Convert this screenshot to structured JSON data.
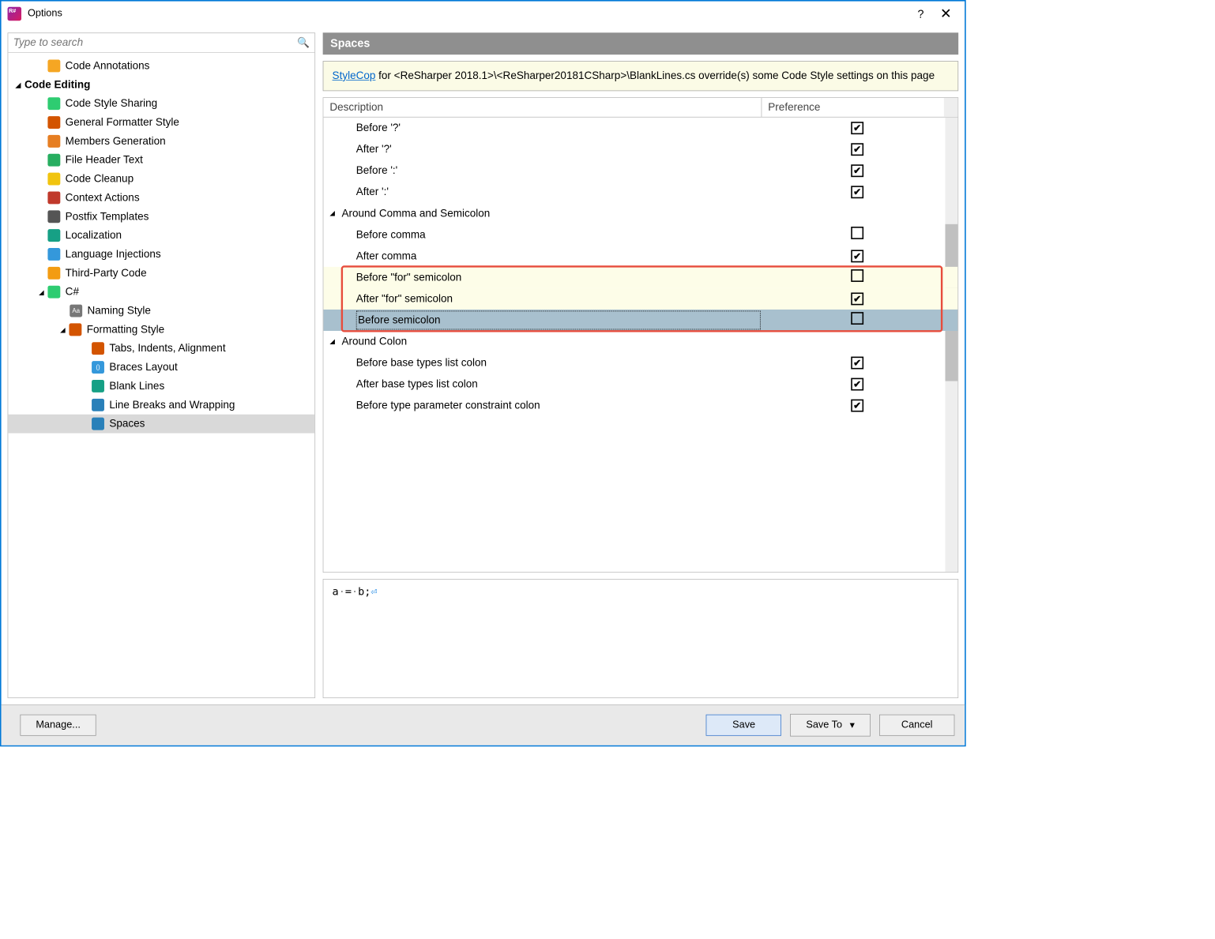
{
  "window": {
    "title": "Options"
  },
  "search": {
    "placeholder": "Type to search"
  },
  "sidebar": {
    "items": [
      {
        "label": "Code Annotations",
        "indent": 55,
        "iconColor": "#f5a623"
      },
      {
        "label": "Code Editing",
        "indent": 18,
        "header": true,
        "exp": "◢"
      },
      {
        "label": "Code Style Sharing",
        "indent": 55,
        "iconColor": "#2ecc71"
      },
      {
        "label": "General Formatter Style",
        "indent": 55,
        "iconColor": "#d35400"
      },
      {
        "label": "Members Generation",
        "indent": 55,
        "iconColor": "#e67e22"
      },
      {
        "label": "File Header Text",
        "indent": 55,
        "iconColor": "#27ae60"
      },
      {
        "label": "Code Cleanup",
        "indent": 55,
        "iconColor": "#f1c40f"
      },
      {
        "label": "Context Actions",
        "indent": 55,
        "iconColor": "#c0392b"
      },
      {
        "label": "Postfix Templates",
        "indent": 55,
        "iconColor": "#555"
      },
      {
        "label": "Localization",
        "indent": 55,
        "iconColor": "#16a085"
      },
      {
        "label": "Language Injections",
        "indent": 55,
        "iconColor": "#3498db"
      },
      {
        "label": "Third-Party Code",
        "indent": 55,
        "iconColor": "#f39c12"
      },
      {
        "label": "C#",
        "indent": 55,
        "iconColor": "#2ecc71",
        "exp": "◢",
        "expIndent": 38
      },
      {
        "label": "Naming Style",
        "indent": 90,
        "iconColor": "#777",
        "iconText": "Aa"
      },
      {
        "label": "Formatting Style",
        "indent": 90,
        "iconColor": "#d35400",
        "exp": "◢",
        "expIndent": 72
      },
      {
        "label": "Tabs, Indents, Alignment",
        "indent": 125,
        "iconColor": "#d35400"
      },
      {
        "label": "Braces Layout",
        "indent": 125,
        "iconColor": "#3498db",
        "iconText": "()"
      },
      {
        "label": "Blank Lines",
        "indent": 125,
        "iconColor": "#16a085"
      },
      {
        "label": "Line Breaks and Wrapping",
        "indent": 125,
        "iconColor": "#2980b9"
      },
      {
        "label": "Spaces",
        "indent": 125,
        "iconColor": "#2980b9",
        "selected": true
      }
    ]
  },
  "panel": {
    "header": "Spaces",
    "infoLink": "StyleCop",
    "infoText": " for <ReSharper 2018.1>\\<ReSharper20181CSharp>\\BlankLines.cs override(s) some Code Style settings on this page",
    "columns": {
      "desc": "Description",
      "pref": "Preference"
    }
  },
  "rows": [
    {
      "label": "Before '?'",
      "indent": 52,
      "checked": true
    },
    {
      "label": "After '?'",
      "indent": 52,
      "checked": true
    },
    {
      "label": "Before ':'",
      "indent": 52,
      "checked": true
    },
    {
      "label": "After ':'",
      "indent": 52,
      "checked": true
    },
    {
      "label": "Around Comma and Semicolon",
      "indent": 10,
      "group": true,
      "exp": "◢"
    },
    {
      "label": "Before comma",
      "indent": 52,
      "checked": false
    },
    {
      "label": "After comma",
      "indent": 52,
      "checked": true
    },
    {
      "label": "Before \"for\" semicolon",
      "indent": 52,
      "checked": false,
      "yellow": true
    },
    {
      "label": "After \"for\" semicolon",
      "indent": 52,
      "checked": true,
      "yellow": true
    },
    {
      "label": "Before semicolon",
      "indent": 52,
      "checked": false,
      "yellow": true,
      "selected": true
    },
    {
      "label": "Around Colon",
      "indent": 10,
      "group": true,
      "exp": "◢"
    },
    {
      "label": "Before base types list colon",
      "indent": 52,
      "checked": true
    },
    {
      "label": "After base types list colon",
      "indent": 52,
      "checked": true
    },
    {
      "label": "Before type parameter constraint colon",
      "indent": 52,
      "checked": true
    }
  ],
  "preview": {
    "text": "a·=·b;␍"
  },
  "footer": {
    "manage": "Manage...",
    "save": "Save",
    "saveTo": "Save To",
    "cancel": "Cancel"
  }
}
